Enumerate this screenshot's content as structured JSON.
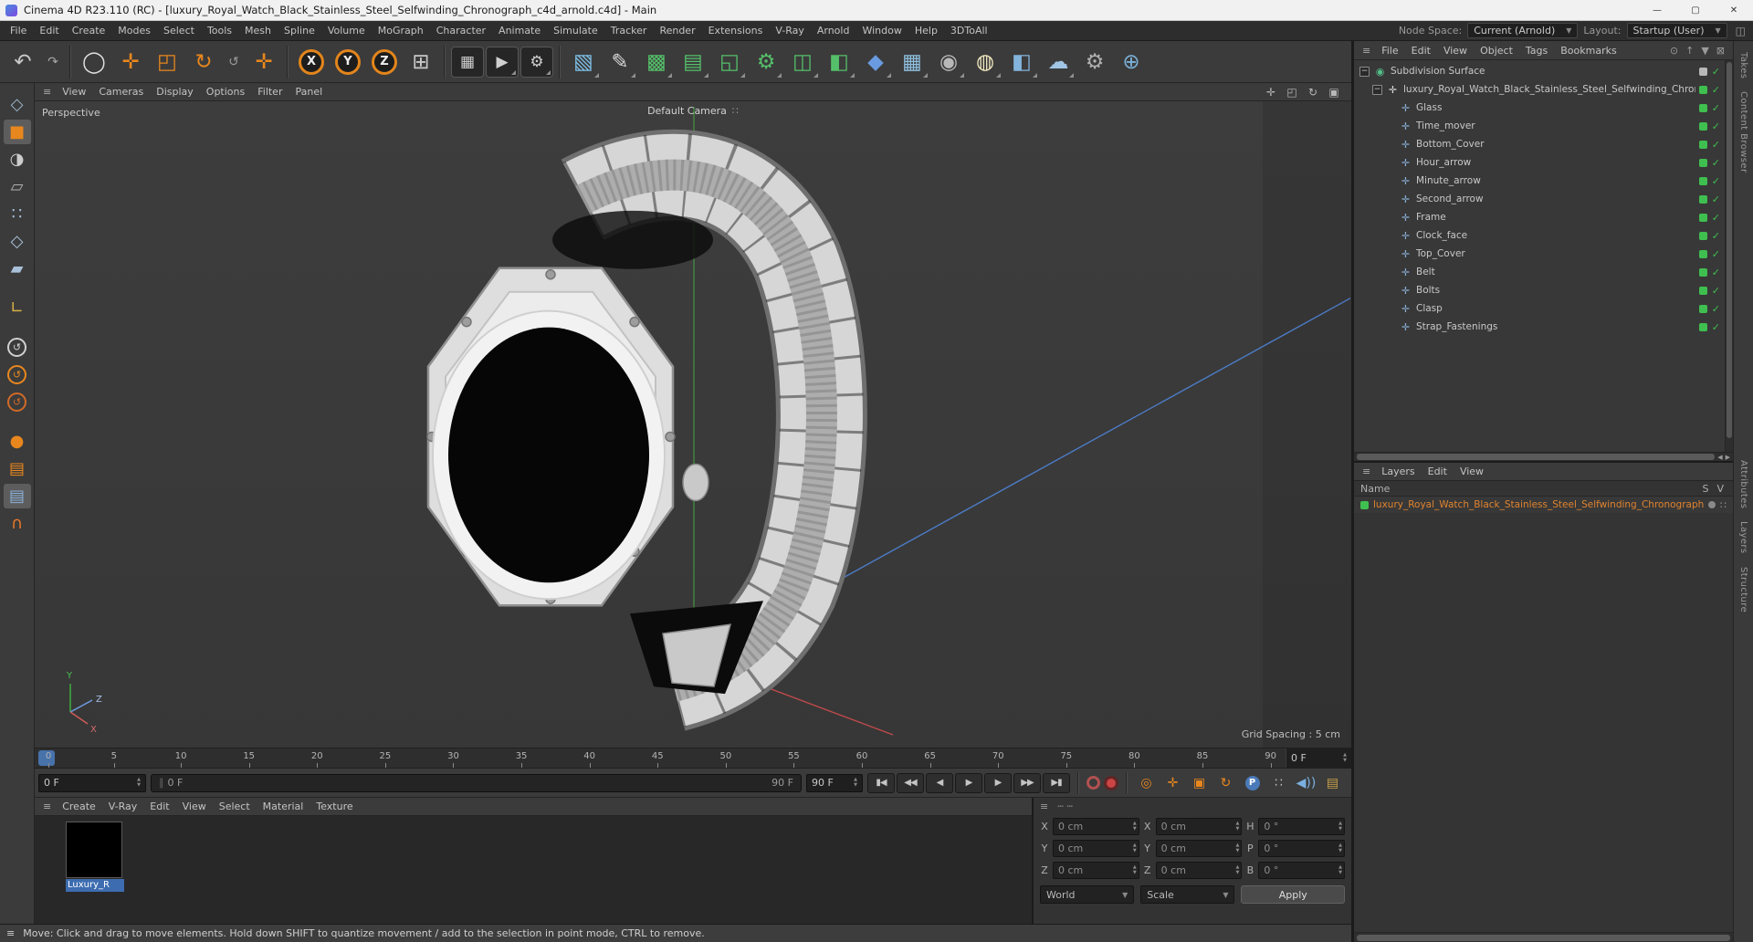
{
  "window": {
    "title": "Cinema 4D R23.110 (RC) - [luxury_Royal_Watch_Black_Stainless_Steel_Selfwinding_Chronograph_c4d_arnold.c4d] - Main",
    "controls": [
      {
        "name": "minimize-button",
        "glyph": "—"
      },
      {
        "name": "maximize-button",
        "glyph": "▢"
      },
      {
        "name": "close-button",
        "glyph": "✕"
      }
    ]
  },
  "icons": {
    "hamburger": "≡",
    "camera_widget": "∷",
    "grip": "∥",
    "up": "▲",
    "down": "▼",
    "collapse": "−",
    "check": "✓",
    "dots": "┄ ┄",
    "left_arrow": "◀",
    "right_arrow": "▶"
  },
  "menubar": {
    "items": [
      "File",
      "Edit",
      "Create",
      "Modes",
      "Select",
      "Tools",
      "Mesh",
      "Spline",
      "Volume",
      "MoGraph",
      "Character",
      "Animate",
      "Simulate",
      "Tracker",
      "Render",
      "Extensions",
      "V-Ray",
      "Arnold",
      "Window",
      "Help",
      "3DToAll"
    ],
    "node_space_label": "Node Space:",
    "node_space_value": "Current (Arnold)",
    "layout_label": "Layout:",
    "layout_value": "Startup (User)",
    "extra_icon": "◫"
  },
  "toolbar": {
    "items": [
      {
        "name": "undo-button",
        "glyph": "↶",
        "color": "#c8c8c8"
      },
      {
        "name": "redo-button",
        "glyph": "↷",
        "color": "#a8a8a8",
        "small": true
      },
      {
        "divider": true
      },
      {
        "name": "live-selection-tool",
        "glyph": "◯",
        "color": "#e0e0e0"
      },
      {
        "name": "move-tool",
        "glyph": "✛",
        "color": "#e8871e"
      },
      {
        "name": "scale-tool",
        "glyph": "◰",
        "color": "#e8871e"
      },
      {
        "name": "rotate-tool",
        "glyph": "↻",
        "color": "#e8871e"
      },
      {
        "name": "last-used-tool",
        "glyph": "↺",
        "color": "#9a9a9a",
        "small": true
      },
      {
        "name": "active-tool-move",
        "glyph": "✛",
        "color": "#e8871e"
      },
      {
        "divider": true
      },
      {
        "name": "lock-x-axis",
        "letter": "X"
      },
      {
        "name": "lock-y-axis",
        "letter": "Y"
      },
      {
        "name": "lock-z-axis",
        "letter": "Z"
      },
      {
        "name": "coordinate-system",
        "glyph": "⊞",
        "color": "#c8c8c8"
      },
      {
        "divider": true
      },
      {
        "name": "render-view-button",
        "glyph": "▦",
        "color": "#d0d0d0",
        "dark": true
      },
      {
        "name": "render-picture-viewer-button",
        "glyph": "▶",
        "color": "#d0d0d0",
        "dark": true,
        "corner": true
      },
      {
        "name": "render-settings-button",
        "glyph": "⚙",
        "color": "#d0d0d0",
        "dark": true,
        "corner": true
      },
      {
        "divider": true
      },
      {
        "name": "add-primitive-cube",
        "glyph": "▧",
        "color": "#7ec0e8",
        "corner": true
      },
      {
        "name": "pen-spline-tool",
        "glyph": "✎",
        "color": "#d8d8d8",
        "corner": true
      },
      {
        "name": "subdivision-surface-generator",
        "glyph": "▩",
        "color": "#55c06a",
        "corner": true
      },
      {
        "name": "extrude-generator",
        "glyph": "▤",
        "color": "#55c06a",
        "corner": true
      },
      {
        "name": "lathe-generator",
        "glyph": "◱",
        "color": "#55c06a",
        "corner": true
      },
      {
        "name": "volume-builder",
        "glyph": "⚙",
        "color": "#55c06a",
        "corner": true
      },
      {
        "name": "array-generator",
        "glyph": "◫",
        "color": "#55c06a",
        "corner": true
      },
      {
        "name": "boole-generator",
        "glyph": "◧",
        "color": "#55c06a",
        "corner": true
      },
      {
        "name": "metaball-deformer",
        "glyph": "◆",
        "color": "#6a9ae0",
        "corner": true
      },
      {
        "name": "mograph-cloner",
        "glyph": "▦",
        "color": "#90c0e0",
        "corner": true
      },
      {
        "name": "motion-tracker",
        "glyph": "◉",
        "color": "#b8b8b8",
        "corner": true
      },
      {
        "name": "light-object",
        "glyph": "◍",
        "color": "#f0e8c0",
        "corner": true
      },
      {
        "name": "floor-object",
        "glyph": "◧",
        "color": "#84b4dc",
        "corner": true
      },
      {
        "name": "sky-object",
        "glyph": "☁",
        "color": "#a0c4e4",
        "corner": true
      },
      {
        "name": "physical-sky-object",
        "glyph": "⚙",
        "color": "#b0b0b0"
      },
      {
        "name": "globe-object",
        "glyph": "⊕",
        "color": "#7ab0d8"
      }
    ]
  },
  "palette": {
    "items": [
      {
        "name": "make-editable",
        "glyph": "◇",
        "color": "#9ab4c8"
      },
      {
        "name": "model-mode",
        "glyph": "■",
        "color": "#e8871e",
        "selected": true
      },
      {
        "name": "texture-mode",
        "glyph": "◑",
        "color": "#cccccc"
      },
      {
        "name": "workplane-mode",
        "glyph": "▱",
        "color": "#b0b0b0"
      },
      {
        "name": "points-mode",
        "glyph": "∷",
        "color": "#a8c0d8"
      },
      {
        "name": "edges-mode",
        "glyph": "◇",
        "color": "#a8c0d8"
      },
      {
        "name": "polygons-mode",
        "glyph": "▰",
        "color": "#a8c0d8"
      },
      {
        "gap": true
      },
      {
        "name": "axis-mode",
        "glyph": "∟",
        "color": "#d8b048"
      },
      {
        "gap": true
      },
      {
        "name": "enable-axis",
        "glyph": "↺",
        "color": "#d0d0d0",
        "circle": true
      },
      {
        "name": "enable-snap",
        "glyph": "↺",
        "color": "#e8871e",
        "circle": true
      },
      {
        "name": "quantize-snap",
        "glyph": "↺",
        "color": "#d06a28",
        "circle": true
      },
      {
        "gap": true
      },
      {
        "name": "viewport-solo",
        "glyph": "●",
        "color": "#e8871e"
      },
      {
        "name": "workplane-xy",
        "glyph": "▤",
        "color": "#e8871e"
      },
      {
        "name": "workplane-zy",
        "glyph": "▤",
        "color": "#8ab0d8",
        "selected": true
      },
      {
        "name": "snap-magnet",
        "glyph": "∩",
        "color": "#e87828"
      }
    ]
  },
  "viewport": {
    "view_label": "Perspective",
    "camera_label": "Default Camera",
    "grid_spacing": "Grid Spacing : 5 cm",
    "menu": [
      "View",
      "Cameras",
      "Display",
      "Options",
      "Filter",
      "Panel"
    ],
    "nav_icons": [
      {
        "name": "pan-view-icon",
        "glyph": "✛"
      },
      {
        "name": "zoom-view-icon",
        "glyph": "◰"
      },
      {
        "name": "rotate-view-icon",
        "glyph": "↻"
      },
      {
        "name": "toggle-view-icon",
        "glyph": "▣"
      }
    ],
    "axis_labels": {
      "x": "X",
      "y": "Y",
      "z": "Z"
    }
  },
  "timeline": {
    "ticks": [
      "0",
      "5",
      "10",
      "15",
      "20",
      "25",
      "30",
      "35",
      "40",
      "45",
      "50",
      "55",
      "60",
      "65",
      "70",
      "75",
      "80",
      "85",
      "90"
    ],
    "frame_field": "0 F",
    "current_frame": "0 F",
    "range_start": "0 F",
    "range_end": "90 F",
    "end_field": "90 F",
    "transport": [
      {
        "name": "goto-start-button",
        "glyph": "▮◀"
      },
      {
        "name": "prev-key-button",
        "glyph": "◀◀"
      },
      {
        "name": "prev-frame-button",
        "glyph": "◀"
      },
      {
        "name": "play-button",
        "glyph": "▶"
      },
      {
        "name": "next-frame-button",
        "glyph": "▶"
      },
      {
        "name": "next-key-button",
        "glyph": "▶▶"
      },
      {
        "name": "goto-end-button",
        "glyph": "▶▮"
      }
    ],
    "record_icons": [
      {
        "name": "record-active-objects-button",
        "kind": "ring"
      },
      {
        "name": "autokeying-button",
        "kind": "solid"
      }
    ],
    "key_icons": [
      {
        "name": "keyframe-selection-icon",
        "glyph": "◎",
        "color": "#e8871e"
      },
      {
        "name": "key-position-icon",
        "glyph": "✛",
        "color": "#e8871e"
      },
      {
        "name": "key-scale-icon",
        "glyph": "▣",
        "color": "#e8871e"
      },
      {
        "name": "key-rotation-icon",
        "glyph": "↻",
        "color": "#e8871e"
      },
      {
        "name": "key-parameter-icon",
        "letter": "P",
        "bg": "#4a7ab8"
      },
      {
        "name": "key-pla-icon",
        "glyph": "∷",
        "color": "#b8b8b8"
      }
    ],
    "extra_icons": [
      {
        "name": "sound-toggle-icon",
        "glyph": "◀))",
        "color": "#7ab0e0"
      },
      {
        "name": "keyframe-presets-icon",
        "glyph": "▤",
        "color": "#c8a048"
      }
    ]
  },
  "materials": {
    "menu": [
      "Create",
      "V-Ray",
      "Edit",
      "View",
      "Select",
      "Material",
      "Texture"
    ],
    "items": [
      {
        "name": "Luxury_R"
      }
    ]
  },
  "coordinates": {
    "rows": [
      {
        "pos_label": "X",
        "pos": "0 cm",
        "size_label": "X",
        "size": "0 cm",
        "rot_label": "H",
        "rot": "0 °"
      },
      {
        "pos_label": "Y",
        "pos": "0 cm",
        "size_label": "Y",
        "size": "0 cm",
        "rot_label": "P",
        "rot": "0 °"
      },
      {
        "pos_label": "Z",
        "pos": "0 cm",
        "size_label": "Z",
        "size": "0 cm",
        "rot_label": "B",
        "rot": "0 °"
      }
    ],
    "world": "World",
    "scale": "Scale",
    "apply": "Apply"
  },
  "object_manager": {
    "menu": [
      "File",
      "Edit",
      "View",
      "Object",
      "Tags",
      "Bookmarks"
    ],
    "header_icons": [
      {
        "name": "search-icon",
        "glyph": "⊙"
      },
      {
        "name": "scroll-first-icon",
        "glyph": "↑"
      },
      {
        "name": "filter-icon",
        "glyph": "▼"
      },
      {
        "name": "lock-icon",
        "glyph": "⊠"
      }
    ],
    "icon_glyphs": {
      "subdivision": "◉",
      "null": "✛",
      "mesh": "✛"
    },
    "root": "Subdivision Surface",
    "group": "luxury_Royal_Watch_Black_Stainless_Steel_Selfwinding_Chronograph",
    "children": [
      "Glass",
      "Time_mover",
      "Bottom_Cover",
      "Hour_arrow",
      "Minute_arrow",
      "Second_arrow",
      "Frame",
      "Clock_face",
      "Top_Cover",
      "Belt",
      "Bolts",
      "Clasp",
      "Strap_Fastenings"
    ]
  },
  "layers_panel": {
    "tabs": [
      "Layers",
      "Edit",
      "View"
    ],
    "name_header": "Name",
    "col_s": "S",
    "col_v": "V",
    "rows": [
      {
        "name": "luxury_Royal_Watch_Black_Stainless_Steel_Selfwinding_Chronograph",
        "color": "#3fbf4f"
      }
    ]
  },
  "side_tabs": {
    "top": [
      "Takes",
      "Content Browser"
    ],
    "middle": [
      "Attributes",
      "Layers",
      "Structure"
    ]
  },
  "statusbar": {
    "text": "Move: Click and drag to move elements. Hold down SHIFT to quantize movement / add to the selection in point mode, CTRL to remove."
  }
}
